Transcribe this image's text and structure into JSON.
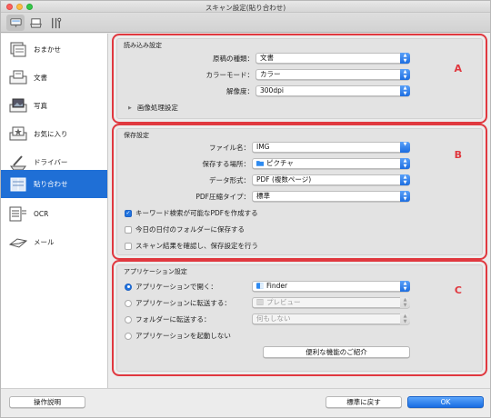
{
  "window": {
    "title": "スキャン設定(貼り合わせ)"
  },
  "toolbar": {
    "items": [
      {
        "name": "scanner-settings",
        "icon": "scanner-icon",
        "selected": true
      },
      {
        "name": "scan-from-operation-panel",
        "icon": "tray-icon",
        "selected": false
      },
      {
        "name": "general-settings",
        "icon": "tools-icon",
        "selected": false
      }
    ]
  },
  "sidebar": {
    "items": [
      {
        "label": "おまかせ",
        "icon": "auto-scan-icon",
        "active": false
      },
      {
        "label": "文書",
        "icon": "document-icon",
        "active": false
      },
      {
        "label": "写真",
        "icon": "photo-icon",
        "active": false
      },
      {
        "label": "お気に入り",
        "icon": "favorite-icon",
        "active": false
      },
      {
        "label": "ドライバー",
        "icon": "driver-icon",
        "active": false
      },
      {
        "label": "貼り合わせ",
        "icon": "stitch-icon",
        "active": true
      },
      {
        "label": "OCR",
        "icon": "ocr-icon",
        "active": false
      },
      {
        "label": "メール",
        "icon": "mail-icon",
        "active": false
      }
    ]
  },
  "scan_options": {
    "title": "読み込み設定",
    "letter": "A",
    "source_label": "原稿の種類：",
    "source_value": "文書",
    "color_mode_label": "カラーモード：",
    "color_mode_value": "カラー",
    "resolution_label": "解像度：",
    "resolution_value": "300dpi",
    "image_processing_label": "画像処理設定"
  },
  "save_settings": {
    "title": "保存設定",
    "letter": "B",
    "file_name_label": "ファイル名：",
    "file_name_value": "IMG",
    "save_in_label": "保存する場所：",
    "save_in_value": "ピクチャ",
    "data_format_label": "データ形式：",
    "data_format_value": "PDF (複数ページ)",
    "pdf_compression_label": "PDF圧縮タイプ：",
    "pdf_compression_value": "標準",
    "checkboxes": [
      {
        "label": "キーワード検索が可能なPDFを作成する",
        "checked": true
      },
      {
        "label": "今日の日付のフォルダーに保存する",
        "checked": false
      },
      {
        "label": "スキャン結果を確認し、保存設定を行う",
        "checked": false
      }
    ]
  },
  "app_settings": {
    "title": "アプリケーション設定",
    "letter": "C",
    "options": [
      {
        "label": "アプリケーションで開く：",
        "selected": true,
        "value": "Finder",
        "enabled": true
      },
      {
        "label": "アプリケーションに転送する：",
        "selected": false,
        "value": "プレビュー",
        "enabled": false
      },
      {
        "label": "フォルダーに転送する：",
        "selected": false,
        "value": "何もしない",
        "enabled": false
      },
      {
        "label": "アプリケーションを起動しない",
        "selected": false
      }
    ],
    "more_functions_label": "便利な機能のご紹介"
  },
  "footer": {
    "instructions_label": "操作説明",
    "defaults_label": "標準に戻す",
    "ok_label": "OK"
  },
  "colors": {
    "accent": "#1f6fd6",
    "highlight_border": "#e0383f"
  }
}
